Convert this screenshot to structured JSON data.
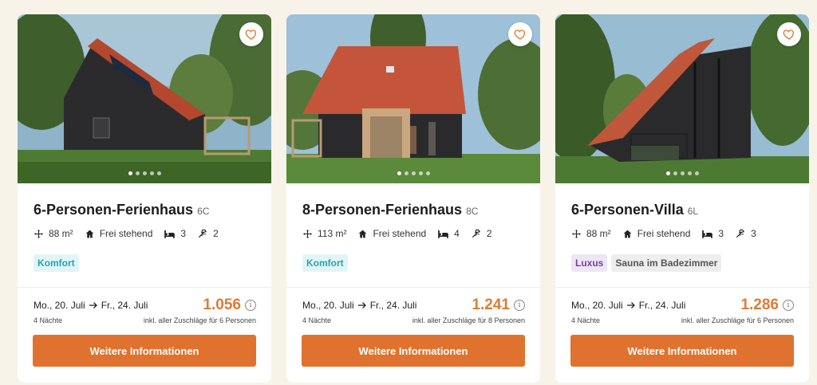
{
  "colors": {
    "accent": "#e0722f",
    "price": "#e07a34",
    "background": "#f8f3e8"
  },
  "icons": {
    "favorite": "heart-icon",
    "area": "move-arrows-icon",
    "type": "house-icon",
    "bedrooms": "bed-icon",
    "bathrooms": "shower-icon",
    "info": "info-icon",
    "arrow": "arrow-right-icon"
  },
  "cards": [
    {
      "title": "6-Personen-Ferienhaus",
      "code": "6C",
      "area": "88 m²",
      "type": "Frei stehend",
      "bedrooms": "3",
      "bathrooms": "2",
      "tags": [
        "Komfort"
      ],
      "date_from": "Mo., 20. Juli",
      "date_to": "Fr., 24. Juli",
      "nights": "4 Nächte",
      "price": "1.056",
      "price_note": "inkl. aller Zuschläge für 6 Personen",
      "button": "Weitere Informationen",
      "image_dots": 5
    },
    {
      "title": "8-Personen-Ferienhaus",
      "code": "8C",
      "area": "113 m²",
      "type": "Frei stehend",
      "bedrooms": "4",
      "bathrooms": "2",
      "tags": [
        "Komfort"
      ],
      "date_from": "Mo., 20. Juli",
      "date_to": "Fr., 24. Juli",
      "nights": "4 Nächte",
      "price": "1.241",
      "price_note": "inkl. aller Zuschläge für 8 Personen",
      "button": "Weitere Informationen",
      "image_dots": 5
    },
    {
      "title": "6-Personen-Villa",
      "code": "6L",
      "area": "88 m²",
      "type": "Frei stehend",
      "bedrooms": "3",
      "bathrooms": "3",
      "tags": [
        "Luxus",
        "Sauna im Badezimmer"
      ],
      "date_from": "Mo., 20. Juli",
      "date_to": "Fr., 24. Juli",
      "nights": "4 Nächte",
      "price": "1.286",
      "price_note": "inkl. aller Zuschläge für 6 Personen",
      "button": "Weitere Informationen",
      "image_dots": 5
    }
  ]
}
